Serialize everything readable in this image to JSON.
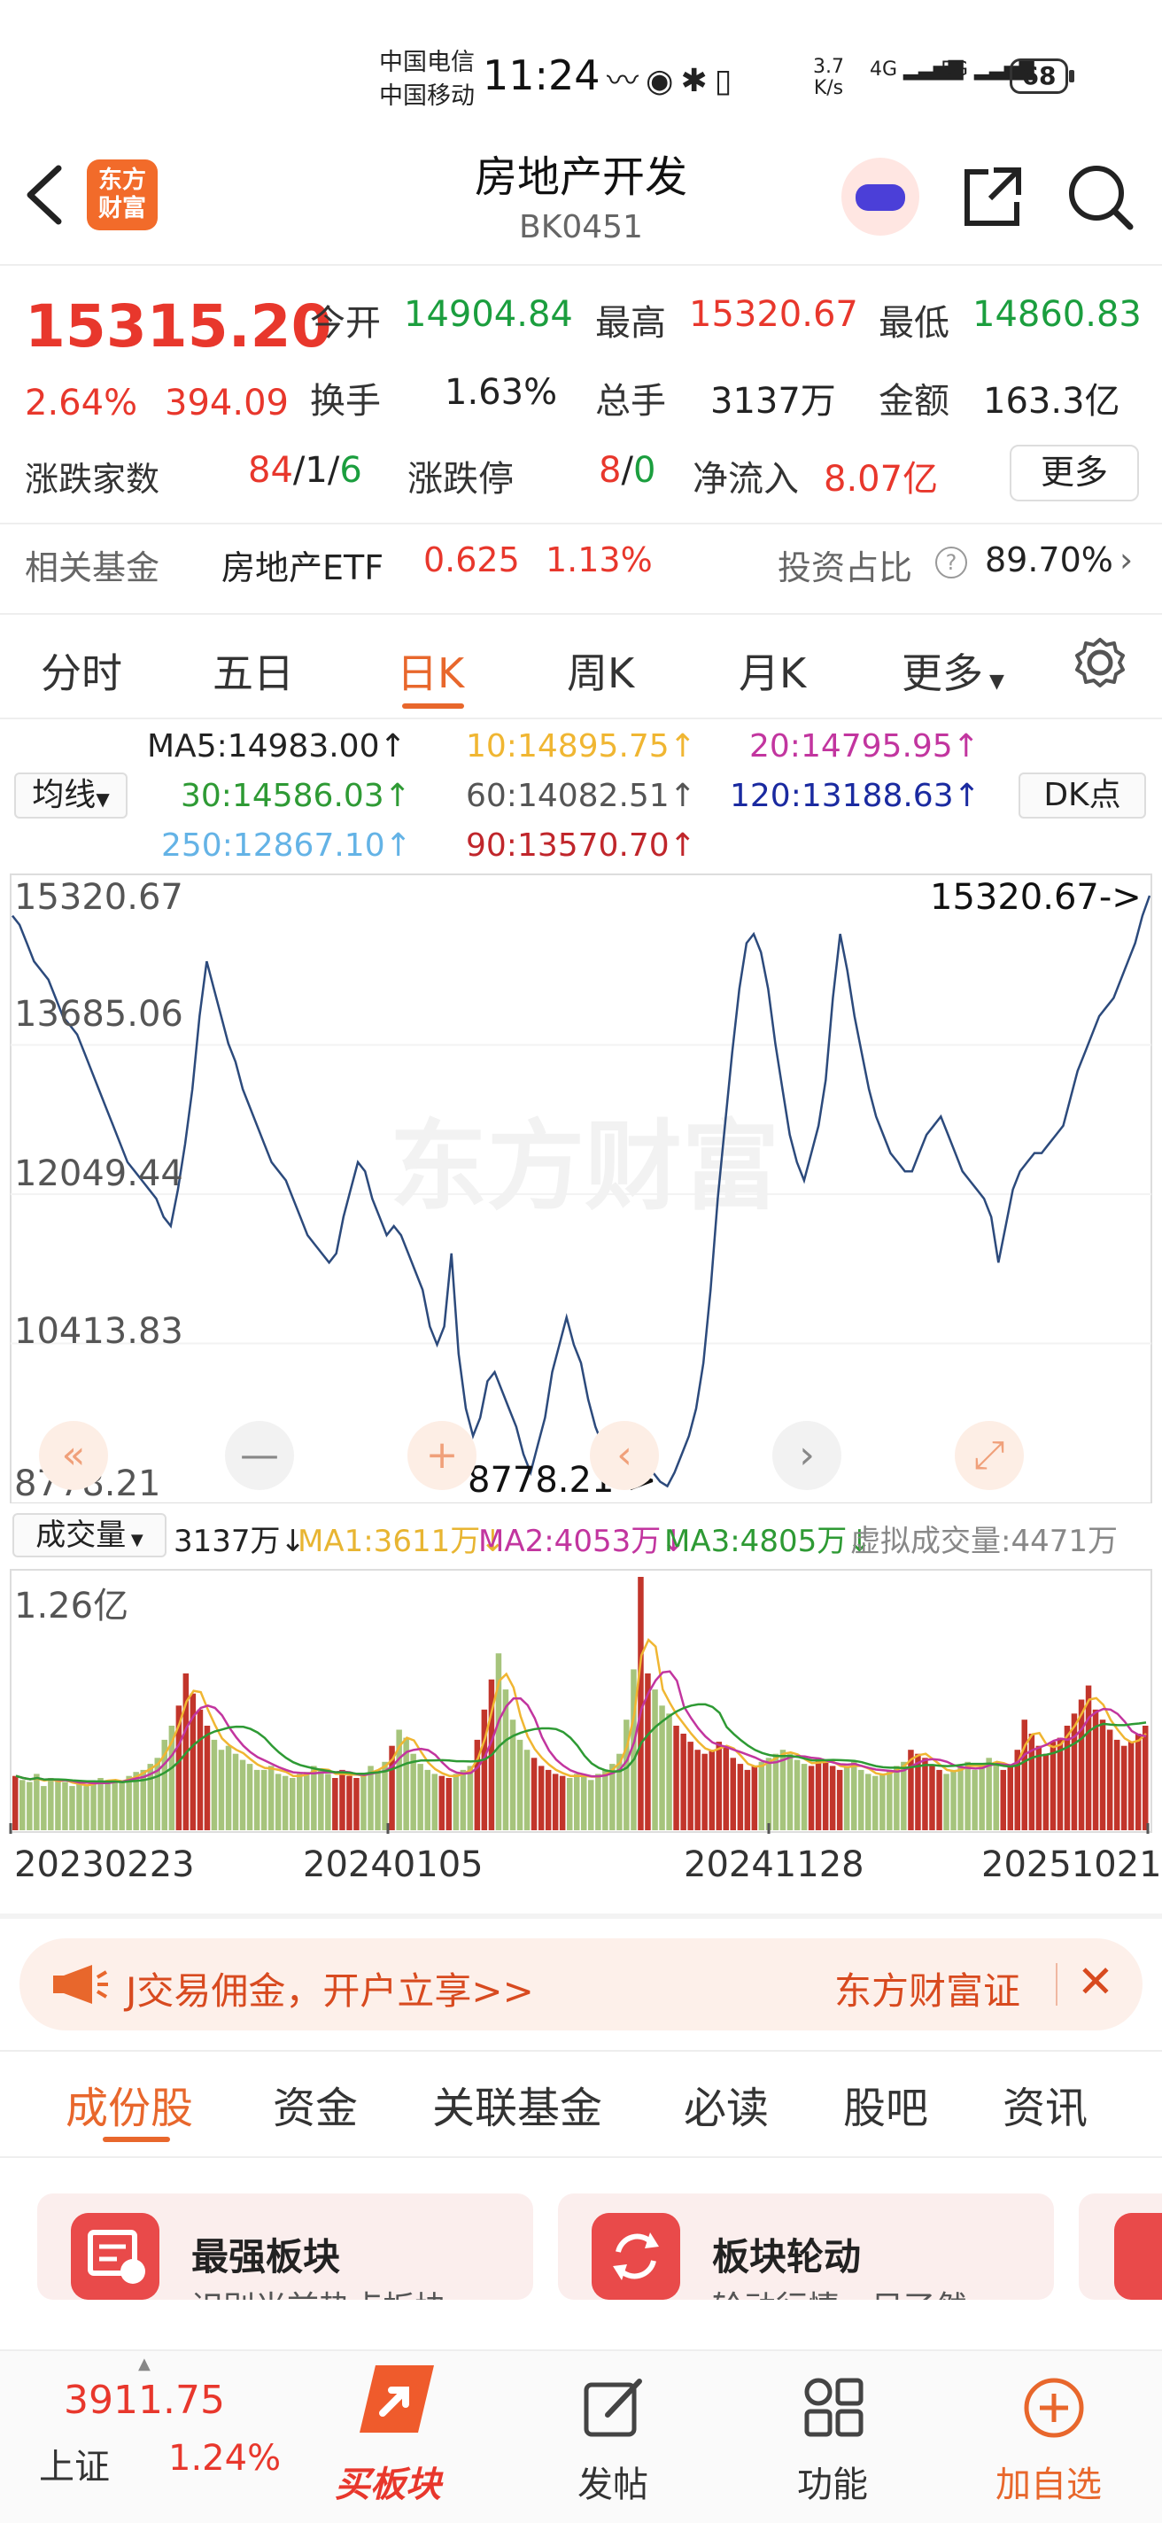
{
  "status_bar": {
    "carrier1": "中国电信",
    "carrier2": "中国移动",
    "time": "11:24",
    "speed_value": "3.7",
    "speed_unit": "K/s",
    "net1": "4G",
    "net2": "5G",
    "battery": "68"
  },
  "header": {
    "logo_text_line1": "东方",
    "logo_text_line2": "财富",
    "title": "房地产开发",
    "code": "BK0451"
  },
  "quote": {
    "price": "15315.20",
    "change_pct": "2.64%",
    "change_abs": "394.09",
    "open_label": "今开",
    "open": "14904.84",
    "high_label": "最高",
    "high": "15320.67",
    "low_label": "最低",
    "low": "14860.83",
    "turnover_label": "换手",
    "turnover": "1.63%",
    "volume_label": "总手",
    "volume": "3137万",
    "amount_label": "金额",
    "amount": "163.3亿",
    "breadth_label": "涨跌家数",
    "breadth_up": "84",
    "breadth_sep1": "/",
    "breadth_flat": "1",
    "breadth_sep2": "/",
    "breadth_down": "6",
    "limit_label": "涨跌停",
    "limit_up": "8",
    "limit_sep": "/",
    "limit_down": "0",
    "netflow_label": "净流入",
    "netflow": "8.07亿",
    "more": "更多"
  },
  "fund": {
    "label": "相关基金",
    "name": "房地产ETF",
    "price": "0.625",
    "pct": "1.13%",
    "ratio_label": "投资占比",
    "ratio": "89.70%"
  },
  "tabs": [
    "分时",
    "五日",
    "日K",
    "周K",
    "月K",
    "更多"
  ],
  "active_tab": "日K",
  "ma_legend": {
    "select": "均线",
    "dk": "DK点",
    "ma5": "MA5:14983.00↑",
    "ma10": "10:14895.75↑",
    "ma20": "20:14795.95↑",
    "ma30": "30:14586.03↑",
    "ma60": "60:14082.51↑",
    "ma120": "120:13188.63↑",
    "ma250": "250:12867.10↑",
    "ma90": "90:13570.70↑"
  },
  "colors": {
    "accent": "#e8672c",
    "up": "#e8372c",
    "down": "#1b9e3e",
    "line": "#2c4a7c",
    "ma10": "#f0b632",
    "ma20": "#c2359f",
    "ma30": "#2e9a34",
    "ma120": "#1a2aa0",
    "ma250": "#64b3e6",
    "ma90": "#c0262b"
  },
  "chart_data": [
    {
      "type": "line",
      "ylim": [
        8778.21,
        15320.67
      ],
      "yticks": [
        "15320.67",
        "13685.06",
        "12049.44",
        "10413.83",
        "8778.21"
      ],
      "max_label": "15320.67->",
      "min_label": "8778.21->",
      "watermark": "东方财富",
      "series": [
        {
          "values": [
            15100,
            15000,
            14800,
            14600,
            14500,
            14400,
            14200,
            14000,
            13900,
            13800,
            13600,
            13400,
            13200,
            13000,
            12800,
            12600,
            12400,
            12300,
            12200,
            12100,
            12000,
            11800,
            11700,
            12100,
            12600,
            13200,
            14000,
            14600,
            14300,
            14000,
            13700,
            13500,
            13200,
            13000,
            12800,
            12600,
            12400,
            12300,
            12200,
            12000,
            11800,
            11600,
            11500,
            11400,
            11300,
            11400,
            11800,
            12100,
            12400,
            12300,
            12000,
            11800,
            11600,
            11700,
            11600,
            11400,
            11200,
            11000,
            10600,
            10400,
            10600,
            11400,
            10300,
            9700,
            9400,
            9600,
            10000,
            10100,
            9900,
            9700,
            9500,
            9200,
            9000,
            9300,
            9600,
            10100,
            10400,
            10700,
            10400,
            10200,
            9800,
            9500,
            9300,
            9200,
            9100,
            9000,
            8950,
            9100,
            9200,
            9000,
            8900,
            8850,
            9000,
            9200,
            9400,
            9700,
            10200,
            11000,
            12000,
            12800,
            13600,
            14300,
            14800,
            14900,
            14700,
            14300,
            13700,
            13200,
            12700,
            12400,
            12200,
            12500,
            12800,
            13300,
            14200,
            14900,
            14500,
            14000,
            13600,
            13200,
            12900,
            12700,
            12500,
            12400,
            12300,
            12300,
            12500,
            12700,
            12800,
            12900,
            12700,
            12500,
            12300,
            12200,
            12100,
            12000,
            11800,
            11300,
            11700,
            12100,
            12300,
            12400,
            12500,
            12500,
            12600,
            12700,
            12800,
            13100,
            13400,
            13600,
            13800,
            14000,
            14100,
            14200,
            14400,
            14600,
            14800,
            15100,
            15320
          ]
        }
      ]
    },
    {
      "type": "bar",
      "title": "成交量",
      "ylim": [
        0,
        1.26
      ],
      "ytick": "1.26亿",
      "x_ticks": [
        "20230223",
        "20240105",
        "20241128",
        "20251021"
      ],
      "legend": {
        "select": "成交量",
        "vol": "3137万↓",
        "ma1": "MA1:3611万↓",
        "ma2": "MA2:4053万↓",
        "ma3": "MA3:4805万↓",
        "virtual": "虚拟成交量:4471万"
      },
      "series": [
        {
          "values": [
            0.27,
            0.25,
            0.24,
            0.28,
            0.22,
            0.26,
            0.25,
            0.24,
            0.22,
            0.23,
            0.22,
            0.24,
            0.26,
            0.24,
            0.25,
            0.24,
            0.27,
            0.29,
            0.3,
            0.33,
            0.36,
            0.45,
            0.52,
            0.62,
            0.78,
            0.68,
            0.6,
            0.52,
            0.45,
            0.4,
            0.42,
            0.38,
            0.35,
            0.33,
            0.3,
            0.3,
            0.32,
            0.28,
            0.27,
            0.26,
            0.28,
            0.29,
            0.32,
            0.3,
            0.28,
            0.26,
            0.3,
            0.27,
            0.26,
            0.28,
            0.32,
            0.3,
            0.34,
            0.42,
            0.5,
            0.46,
            0.38,
            0.33,
            0.3,
            0.28,
            0.27,
            0.26,
            0.28,
            0.3,
            0.32,
            0.45,
            0.6,
            0.75,
            0.88,
            0.7,
            0.55,
            0.45,
            0.4,
            0.36,
            0.32,
            0.3,
            0.28,
            0.27,
            0.26,
            0.28,
            0.27,
            0.25,
            0.28,
            0.3,
            0.33,
            0.38,
            0.55,
            0.8,
            1.26,
            0.78,
            0.7,
            0.62,
            0.58,
            0.52,
            0.48,
            0.44,
            0.4,
            0.38,
            0.4,
            0.44,
            0.42,
            0.36,
            0.33,
            0.3,
            0.32,
            0.34,
            0.36,
            0.38,
            0.4,
            0.38,
            0.35,
            0.33,
            0.32,
            0.36,
            0.34,
            0.32,
            0.3,
            0.32,
            0.34,
            0.3,
            0.28,
            0.27,
            0.28,
            0.3,
            0.32,
            0.34,
            0.4,
            0.38,
            0.36,
            0.32,
            0.3,
            0.28,
            0.3,
            0.32,
            0.34,
            0.3,
            0.32,
            0.36,
            0.34,
            0.3,
            0.32,
            0.4,
            0.55,
            0.48,
            0.42,
            0.38,
            0.44,
            0.46,
            0.52,
            0.58,
            0.65,
            0.72,
            0.6,
            0.55,
            0.5,
            0.45,
            0.42,
            0.44,
            0.48,
            0.52
          ]
        }
      ]
    }
  ],
  "chart_controls": {
    "rewind": "«",
    "zoom_out": "—",
    "zoom_in": "+",
    "prev": "‹",
    "next": "›",
    "expand": "⤢"
  },
  "banner": {
    "text": "J交易佣金，开户立享>>",
    "brand": "东方财富证",
    "close": "✕"
  },
  "sub_tabs": [
    "成份股",
    "资金",
    "关联基金",
    "必读",
    "股吧",
    "资讯"
  ],
  "active_sub_tab": "成份股",
  "cards": [
    {
      "title": "最强板块",
      "subtitle": "识别当前热点板块"
    },
    {
      "title": "板块轮动",
      "subtitle": "轮动行情一目了然"
    }
  ],
  "bottom_nav": {
    "index_value": "3911.75",
    "index_name": "上证",
    "index_pct": "1.24%",
    "buy_label": "买板块",
    "post_label": "发帖",
    "func_label": "功能",
    "add_label": "加自选"
  }
}
